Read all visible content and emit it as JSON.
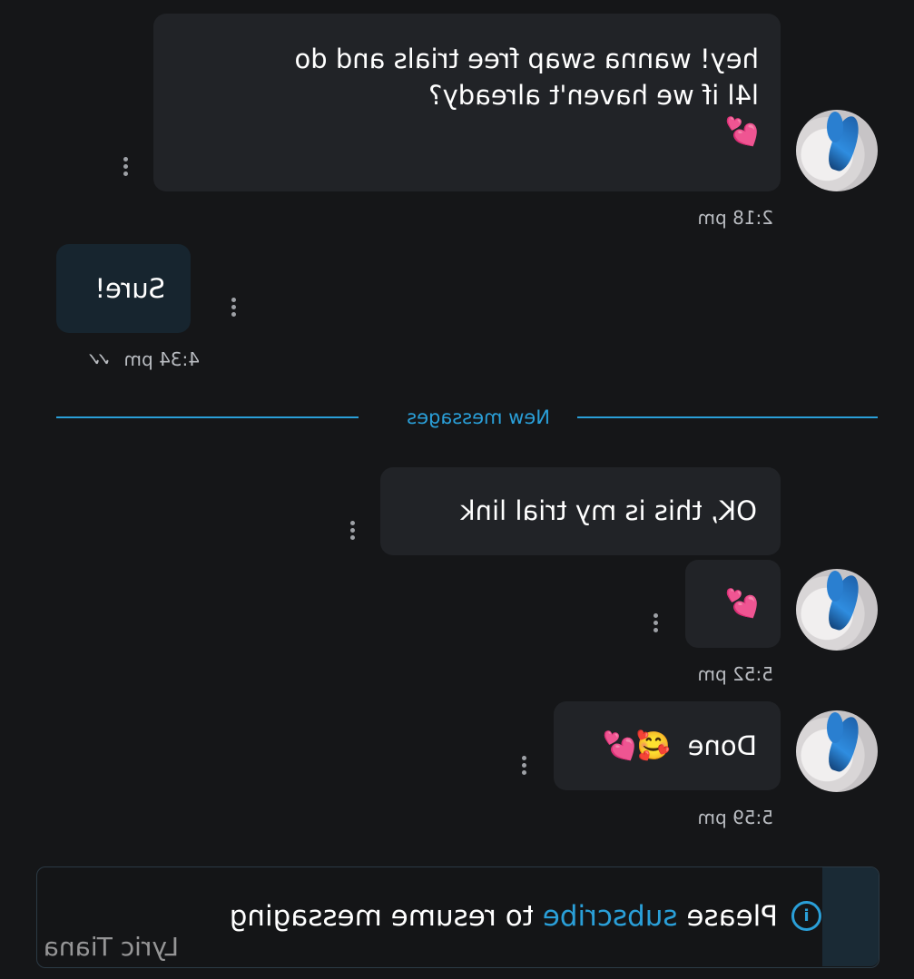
{
  "messages": [
    {
      "id": "m1",
      "direction": "received",
      "text": "hey! wanna swap free trials and do\nl4l if we haven't already?",
      "emoji": "💕",
      "time": "2:18 pm"
    },
    {
      "id": "m2",
      "direction": "sent",
      "text": "Sure!",
      "time": "4:34 pm",
      "status_icon": "double-check-icon"
    },
    {
      "id": "m3",
      "direction": "received",
      "text": "OK, this is my trial link"
    },
    {
      "id": "m4",
      "direction": "received",
      "emoji": "💕",
      "time": "5:52 pm"
    },
    {
      "id": "m5",
      "direction": "received",
      "text": "Done",
      "emoji": "🥰💕",
      "time": "5:59 pm"
    }
  ],
  "separator": {
    "label": "New messages"
  },
  "notice": {
    "prefix": "Please ",
    "link": "subscribe",
    "suffix": " to resume messaging",
    "icon": "info-icon"
  },
  "watermark": "Lyric Tiana",
  "colors": {
    "background": "#151618",
    "bubble": "#212327",
    "sent_bubble": "#17252f",
    "accent": "#2a9fd8",
    "heart": "#ff2e8a"
  }
}
